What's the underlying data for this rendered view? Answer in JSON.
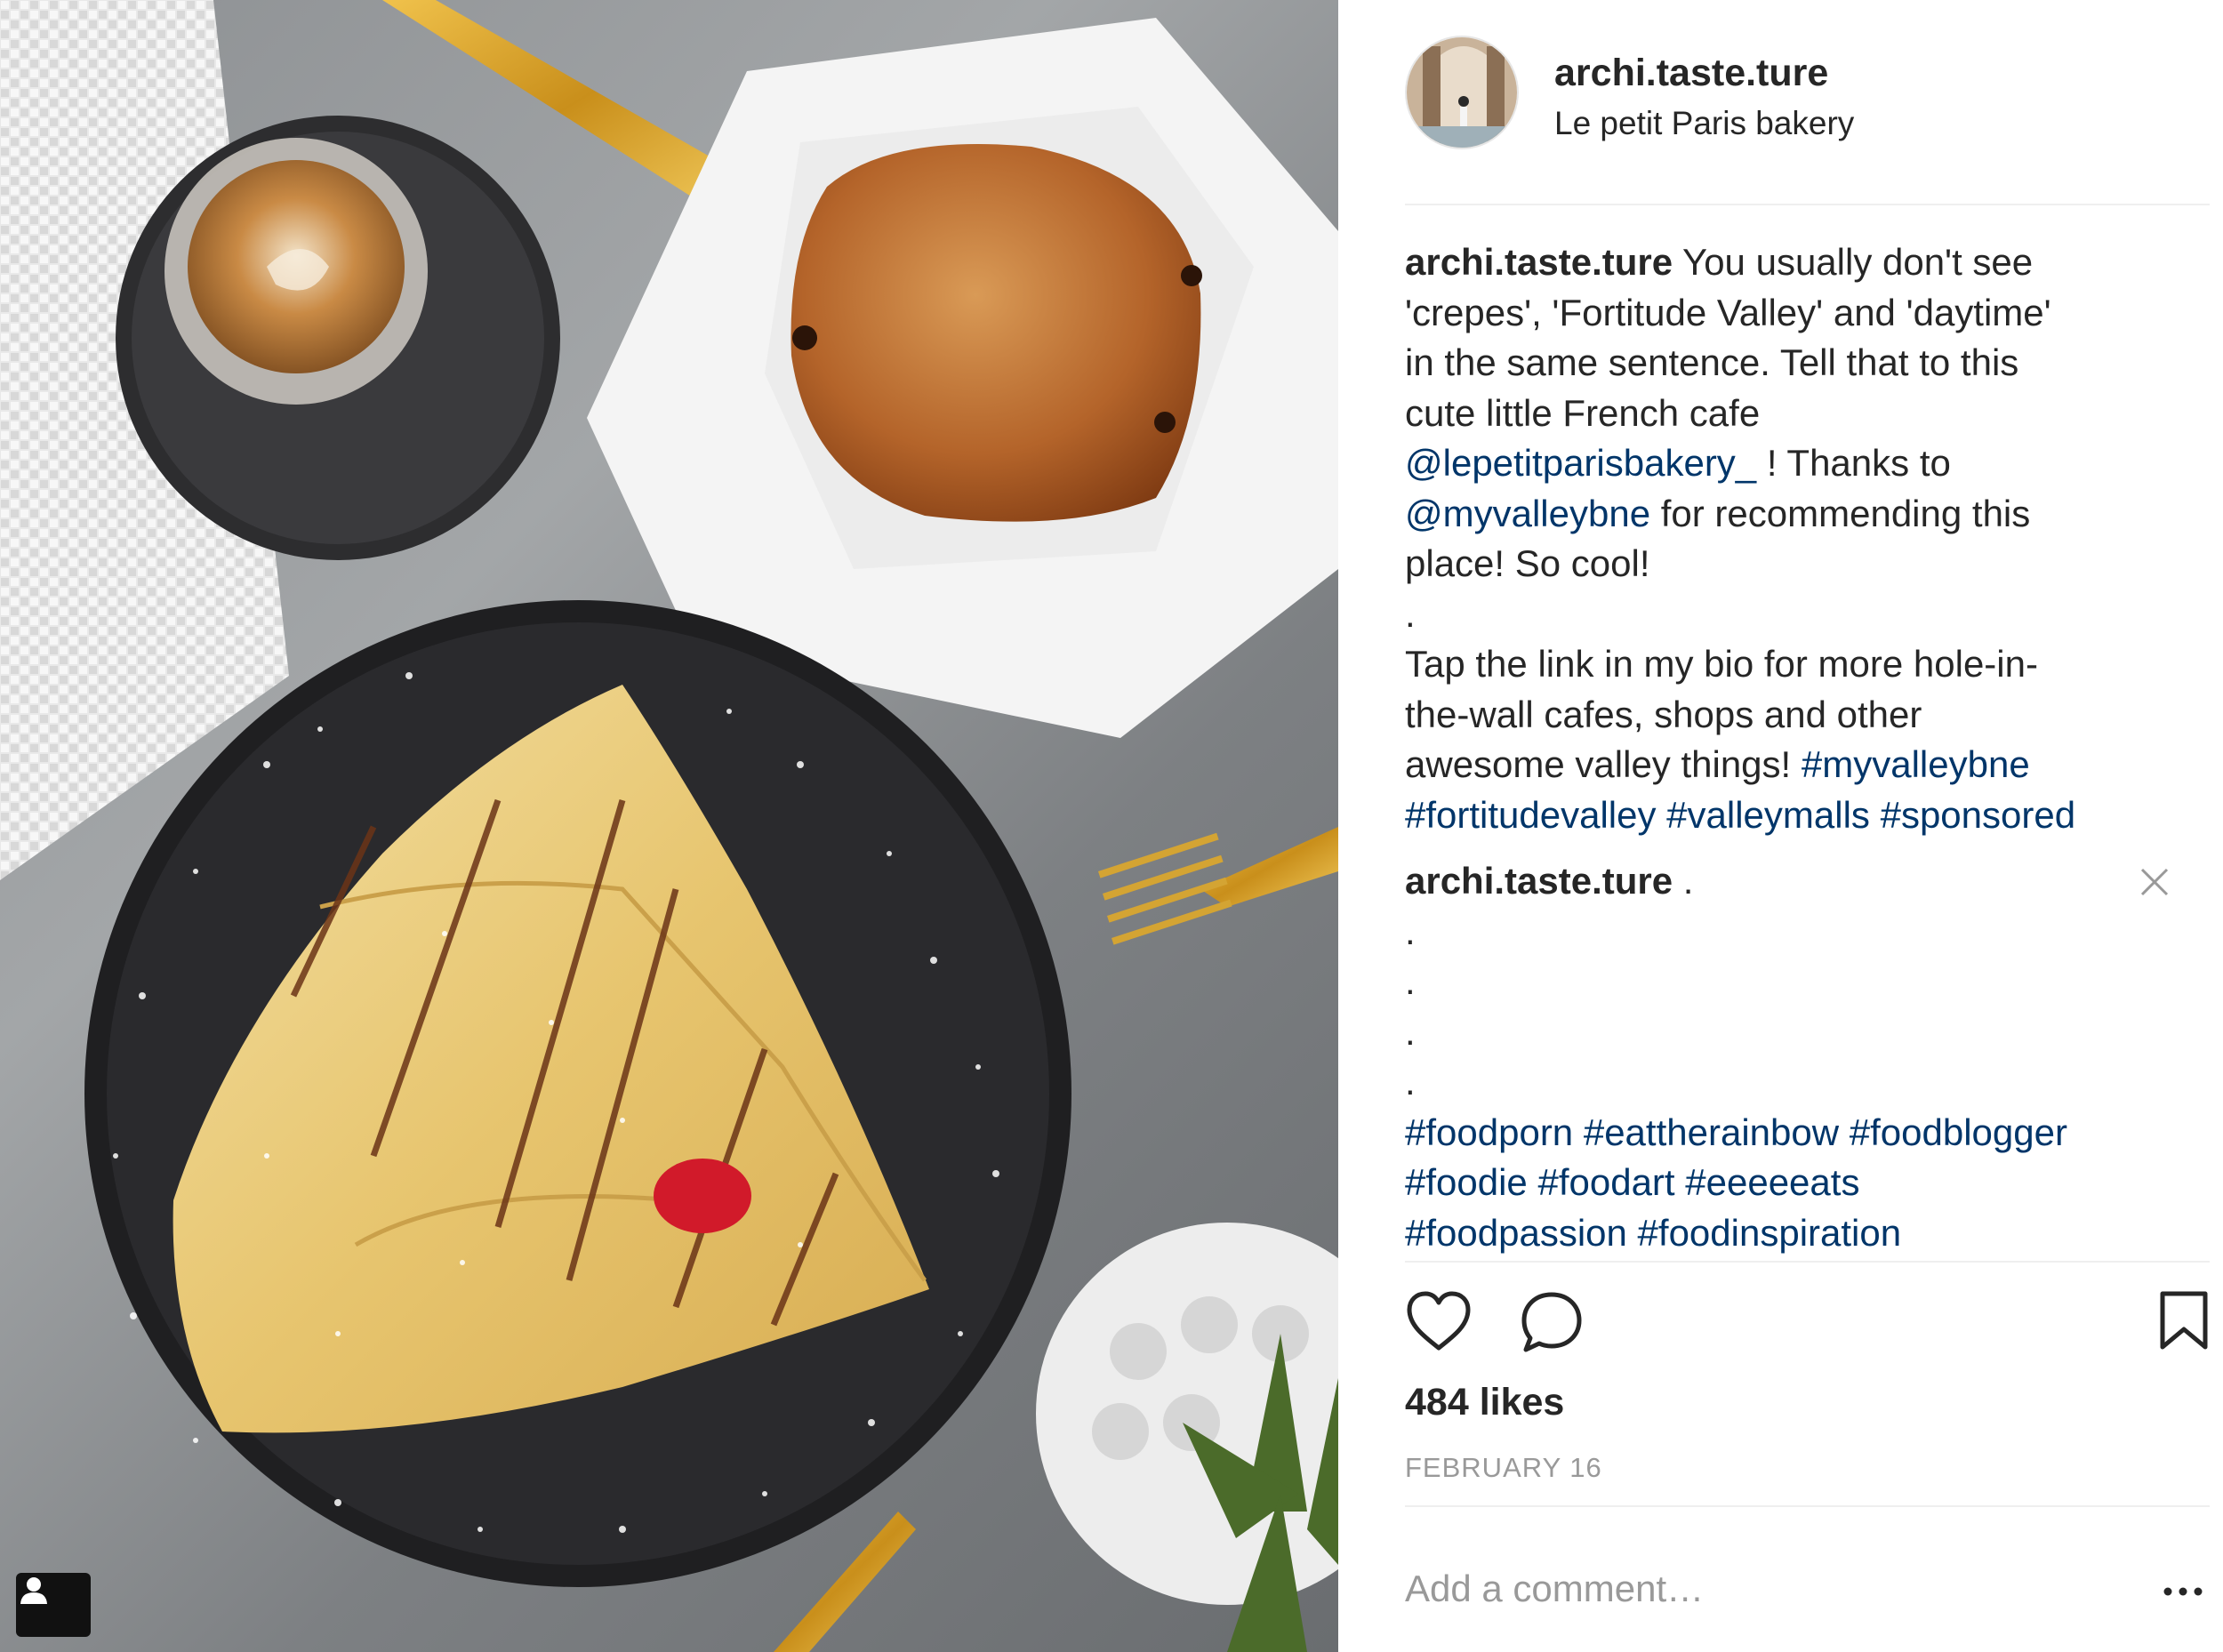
{
  "post": {
    "image_alt": "Crepe with powdered sugar, coffee and pain au chocolat",
    "author": {
      "username": "archi.taste.ture",
      "location": "Le petit Paris bakery"
    }
  },
  "caption": {
    "username": "archi.taste.ture",
    "l1": " You usually don't see",
    "l2": "'crepes', 'Fortitude Valley' and 'daytime'",
    "l3": "in the same sentence. Tell that to this",
    "l4": "cute little French cafe",
    "mention1": "@lepetitparisbakery_",
    "l5_rest": " ! Thanks to",
    "mention2": "@myvalleybne",
    "l6_rest": " for recommending this",
    "l7": "place! So cool!",
    "l8": ".",
    "l9": "Tap the link in my bio for more hole-in-",
    "l10": "the-wall cafes, shops and other",
    "l11": "awesome valley things! ",
    "tag_myvalleybne": "#myvalleybne",
    "tag_fortitudevalley": "#fortitudevalley",
    "tag_valleymalls": "#valleymalls",
    "tag_sponsored": "#sponsored"
  },
  "comment2": {
    "username": "archi.taste.ture",
    "text": " .",
    "dot1": ".",
    "dot2": ".",
    "dot3": ".",
    "dot4": ".",
    "tag_foodporn": "#foodporn",
    "tag_eattherainbow": "#eattherainbow",
    "tag_foodblogger": "#foodblogger",
    "tag_foodie": "#foodie",
    "tag_foodart": "#foodart",
    "tag_eeeeeats": "#eeeeeats",
    "tag_foodpassion": "#foodpassion",
    "tag_foodinspiration": "#foodinspiration"
  },
  "actions": {
    "like_icon": "heart-icon",
    "comment_icon": "comment-bubble-icon",
    "save_icon": "bookmark-icon"
  },
  "likes_text": "484 likes",
  "date_text": "FEBRUARY 16",
  "comment_input": {
    "placeholder": "Add a comment…",
    "value": ""
  },
  "more_label": "•••",
  "colors": {
    "link": "#003569",
    "text": "#262626",
    "muted": "#999999",
    "divider": "#efefef"
  }
}
